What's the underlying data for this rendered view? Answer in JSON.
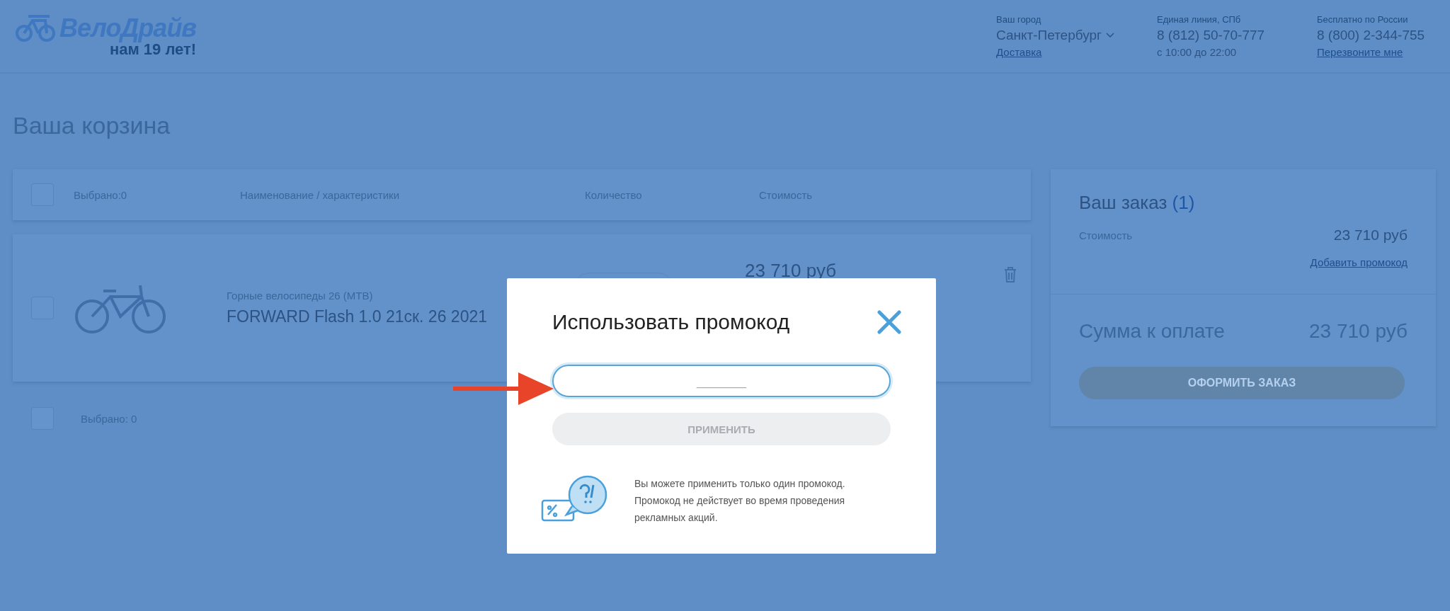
{
  "header": {
    "logo": {
      "name": "ВелоДрайв",
      "tagline": "нам **19** лет!"
    },
    "contacts": [
      {
        "label": "Ваш город",
        "value": "Санкт-Петербург",
        "dropdown": true,
        "link": "Доставка"
      },
      {
        "label": "Единая линия, СПб",
        "value": "8 (812) 50-70-777",
        "note": "с 10:00 до 22:00"
      },
      {
        "label": "Бесплатно по России",
        "value": "8 (800) 2-344-755",
        "link": "Перезвоните мне"
      }
    ]
  },
  "page_title": "Ваша корзина",
  "cart": {
    "header": {
      "checked": false,
      "selected_label": "Выбрано:0",
      "columns": [
        "Наименование / характеристики",
        "Количество",
        "Стоимость"
      ]
    },
    "items": [
      {
        "checked": false,
        "category": "Горные велосипеды 26 (MTB)",
        "name": "FORWARD Flash 1.0 21ск. 26 2021",
        "price": "23 710 руб"
      }
    ],
    "footer": {
      "checked": false,
      "selected_label": "Выбрано: 0"
    }
  },
  "order": {
    "title": "Ваш заказ",
    "count": "(1)",
    "cost_label": "Стоимость",
    "cost": "23 710 руб",
    "promo_link": "Добавить промокод",
    "total_label": "Сумма к оплате",
    "total": "23 710 руб",
    "checkout": {
      "label": "ОФОРМИТЬ ЗАКАЗ",
      "disabled": true
    }
  },
  "modal": {
    "title": "Использовать промокод",
    "placeholder": "_______",
    "apply": {
      "label": "ПРИМЕНИТЬ",
      "disabled": true
    },
    "info": "Вы можете применить только один промокод. Промокод не действует во время проведения рекламных акций."
  }
}
